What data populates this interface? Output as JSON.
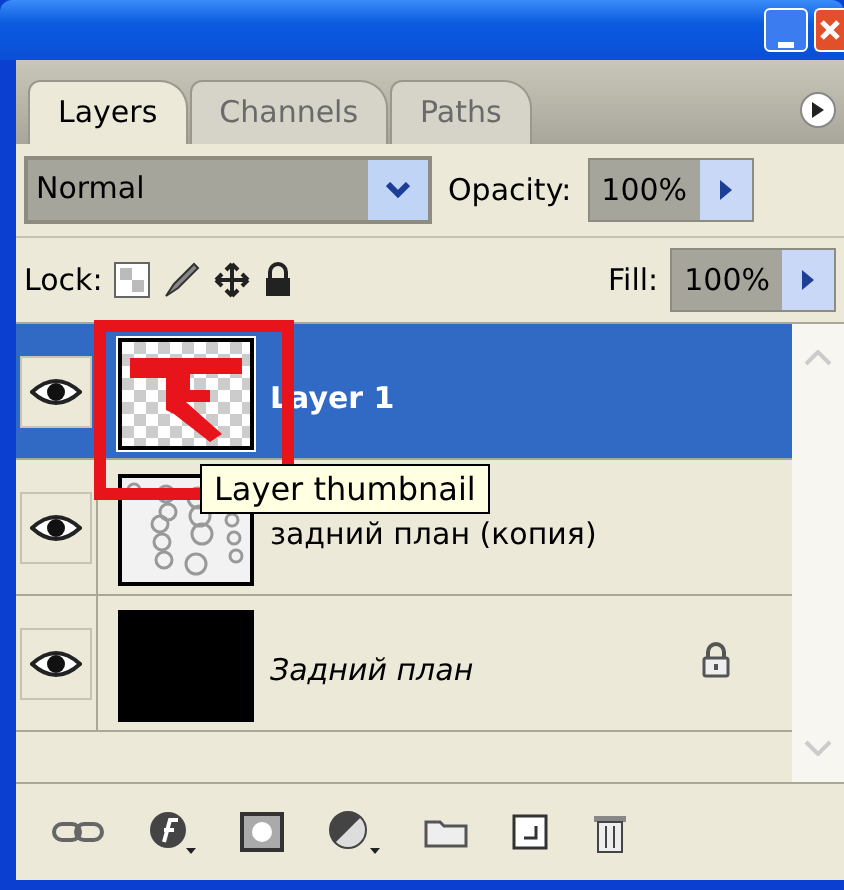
{
  "tabs": [
    {
      "label": "Layers",
      "selected": true
    },
    {
      "label": "Channels",
      "selected": false
    },
    {
      "label": "Paths",
      "selected": false
    }
  ],
  "blend_mode": {
    "value": "Normal"
  },
  "opacity": {
    "label": "Opacity:",
    "value": "100%"
  },
  "lock": {
    "label": "Lock:"
  },
  "fill": {
    "label": "Fill:",
    "value": "100%"
  },
  "layers": [
    {
      "name": "Layer 1",
      "selected": true,
      "visible": true,
      "locked": false,
      "kind": "layer",
      "thumbnail": {
        "kind": "red-shape"
      }
    },
    {
      "name": "задний план (копия)",
      "selected": false,
      "visible": true,
      "locked": false,
      "kind": "layer",
      "thumbnail": {
        "kind": "sketch"
      }
    },
    {
      "name": "Задний план",
      "selected": false,
      "visible": true,
      "locked": true,
      "kind": "background",
      "thumbnail": {
        "kind": "black"
      }
    }
  ],
  "tooltip": {
    "text": "Layer thumbnail"
  }
}
